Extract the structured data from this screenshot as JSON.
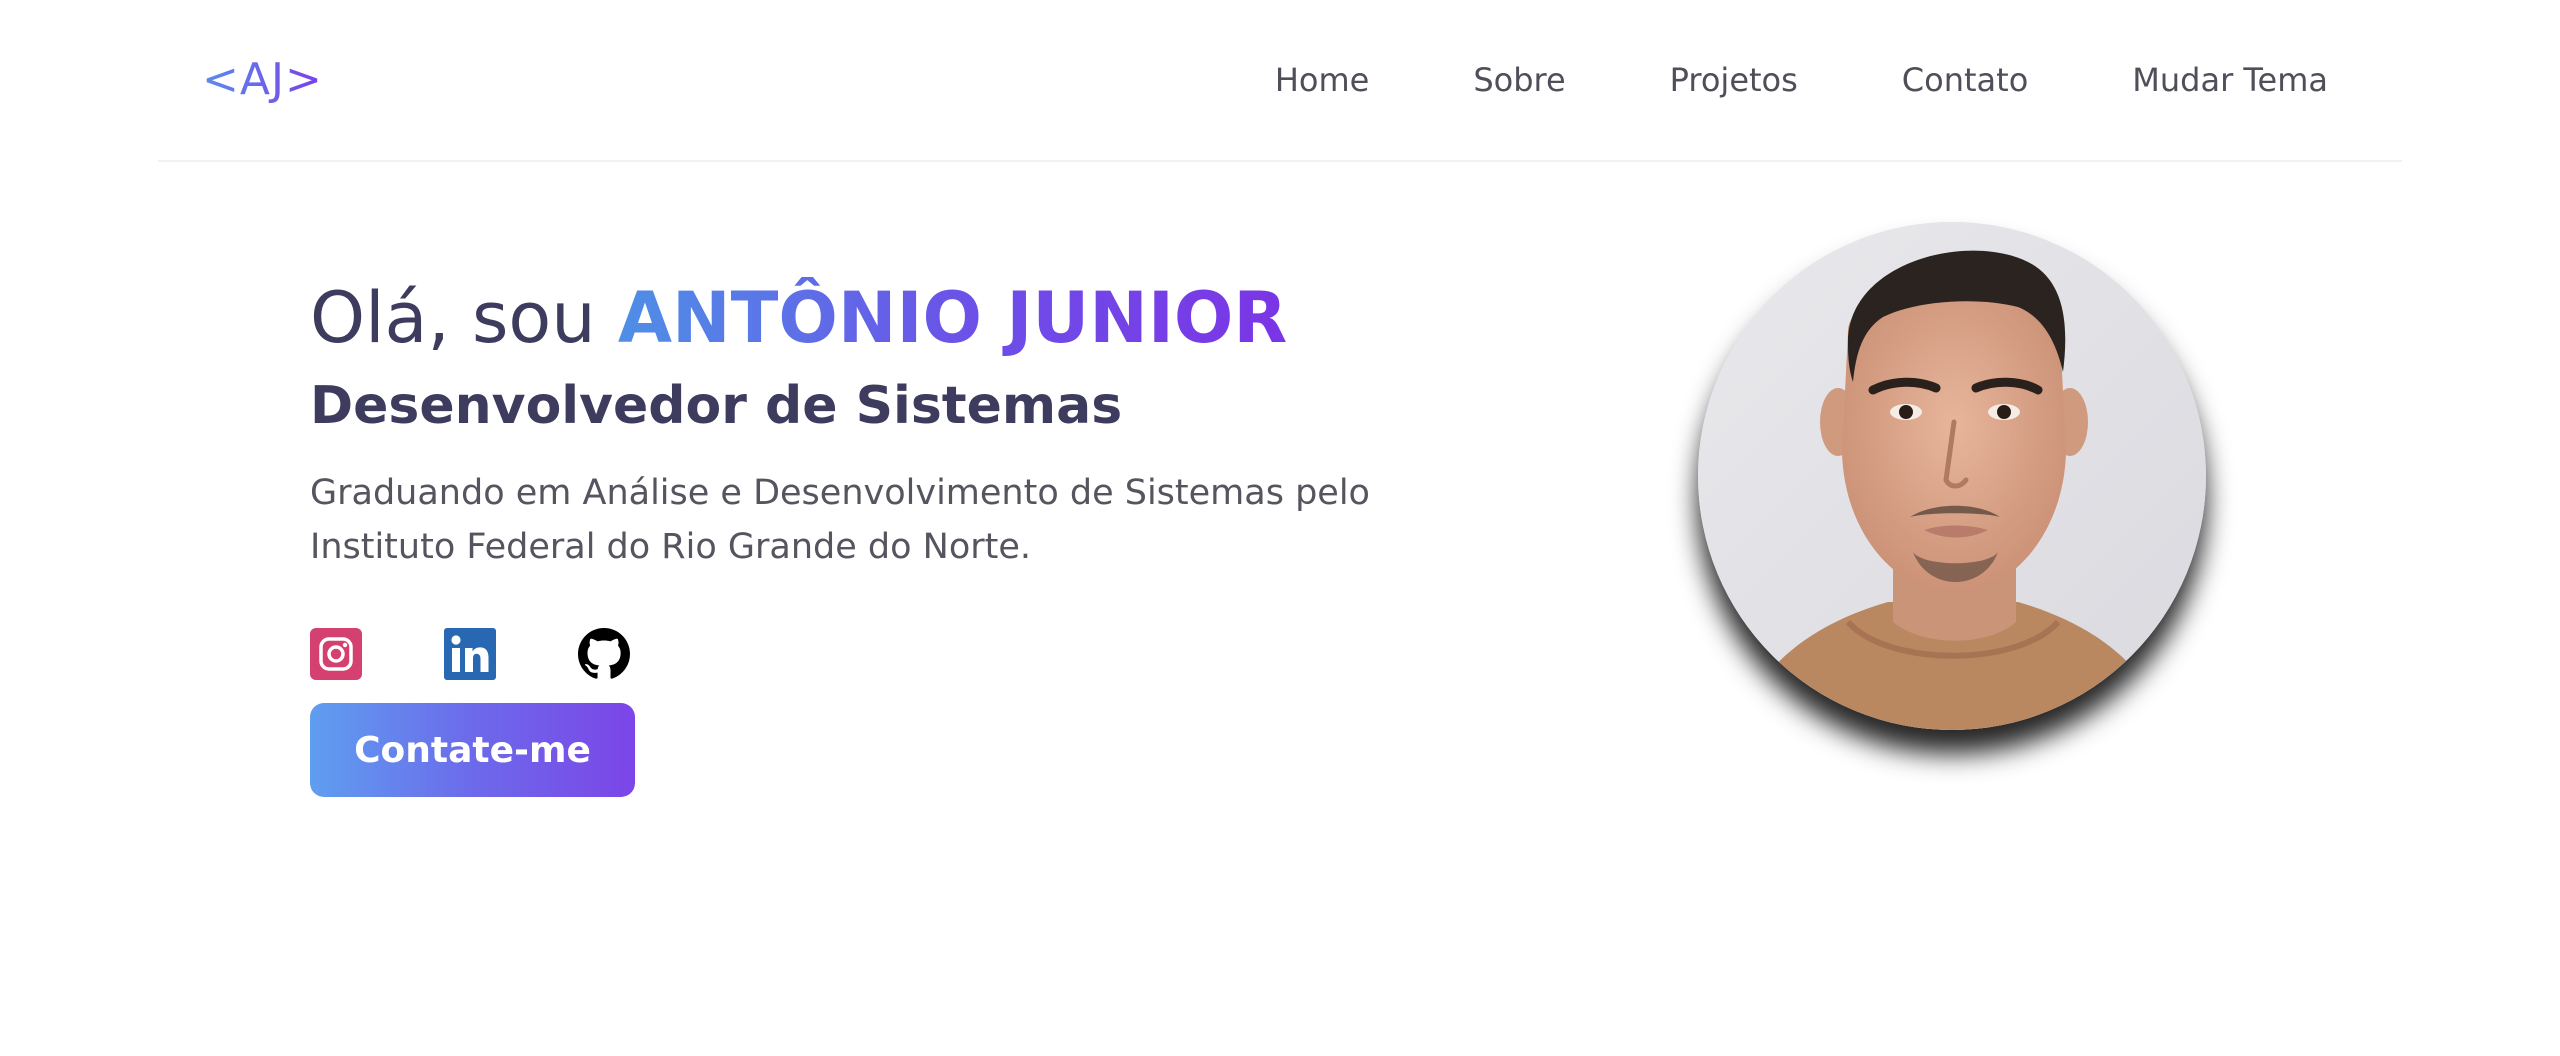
{
  "header": {
    "logo": "<AJ>",
    "nav": [
      {
        "label": "Home"
      },
      {
        "label": "Sobre"
      },
      {
        "label": "Projetos"
      },
      {
        "label": "Contato"
      },
      {
        "label": "Mudar Tema"
      }
    ]
  },
  "hero": {
    "greeting_prefix": "Olá, sou ",
    "name": "ANTÔNIO JUNIOR",
    "role": "Desenvolvedor de Sistemas",
    "description": "Graduando em Análise e Desenvolvimento de Sistemas pelo Instituto Federal do Rio Grande do Norte.",
    "cta_label": "Contate-me"
  },
  "socials": [
    {
      "icon": "instagram-icon",
      "color": "#d4406f"
    },
    {
      "icon": "linkedin-icon",
      "color": "#2867b2"
    },
    {
      "icon": "github-icon",
      "color": "#000000"
    }
  ],
  "colors": {
    "accent_start": "#5a8dec",
    "accent_end": "#7b3fe8",
    "heading": "#3d3b5e",
    "body_text": "#55555f"
  }
}
